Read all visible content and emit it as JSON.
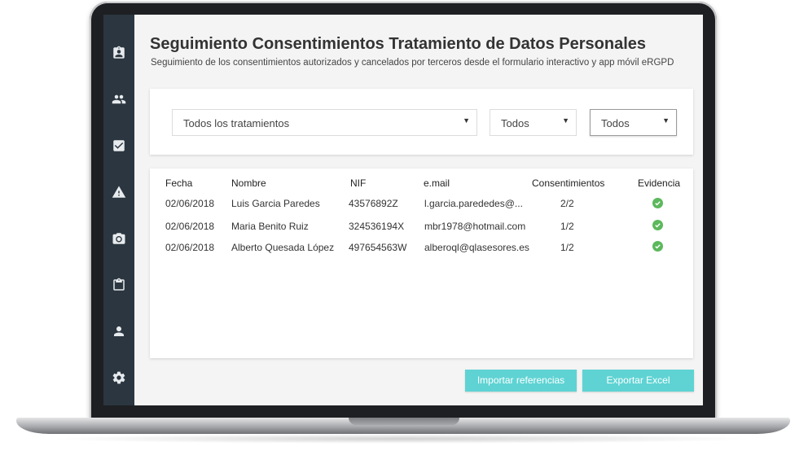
{
  "header": {
    "title": "Seguimiento Consentimientos Tratamiento de Datos Personales",
    "subtitle": "Seguimiento de los consentimientos autorizados y cancelados por terceros desde el formulario interactivo y app móvil eRGPD"
  },
  "sidebar": {
    "items": [
      {
        "icon": "clipboard-badge-icon"
      },
      {
        "icon": "people-icon"
      },
      {
        "icon": "checkbox-icon"
      },
      {
        "icon": "warning-icon"
      },
      {
        "icon": "camera-icon"
      },
      {
        "icon": "clipboard-icon"
      },
      {
        "icon": "person-icon"
      },
      {
        "icon": "gear-icon"
      }
    ]
  },
  "filters": {
    "treatment": "Todos los tratamientos",
    "filter2": "Todos",
    "filter3": "Todos",
    "arrow": "▼"
  },
  "table": {
    "headers": {
      "fecha": "Fecha",
      "nombre": "Nombre",
      "nif": "NIF",
      "email": "e.mail",
      "consentimientos": "Consentimientos",
      "evidencia": "Evidencia"
    },
    "rows": [
      {
        "fecha": "02/06/2018",
        "nombre": "Luis Garcia Paredes",
        "nif": "43576892Z",
        "email": "l.garcia.parededes@...",
        "consentimientos": "2/2",
        "evidencia": "check-icon"
      },
      {
        "fecha": "02/06/2018",
        "nombre": "Maria Benito Ruiz",
        "nif": "324536194X",
        "email": "mbr1978@hotmail.com",
        "consentimientos": "1/2",
        "evidencia": "check-icon"
      },
      {
        "fecha": "02/06/2018",
        "nombre": "Alberto Quesada López",
        "nif": "497654563W",
        "email": "alberoql@qlasesores.es",
        "consentimientos": "1/2",
        "evidencia": "check-icon"
      }
    ]
  },
  "actions": {
    "import_label": "Importar referencias",
    "export_label": "Exportar Excel"
  },
  "colors": {
    "sidebar": "#2b3640",
    "accent": "#5fd3d3",
    "success": "#5cb85c"
  }
}
